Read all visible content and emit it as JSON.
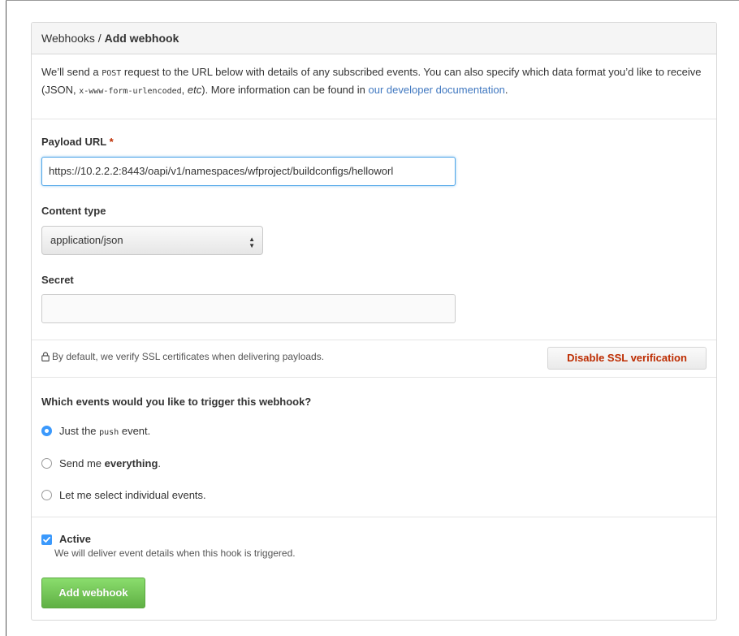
{
  "header": {
    "breadcrumb_parent": "Webhooks",
    "breadcrumb_sep": " / ",
    "breadcrumb_current": "Add webhook"
  },
  "intro": {
    "text1": "We’ll send a ",
    "code1": "POST",
    "text2": " request to the URL below with details of any subscribed events. You can also specify which data format you’d like to receive (JSON, ",
    "code2": "x-www-form-urlencoded",
    "text3": ", ",
    "etc": "etc",
    "text4": "). More information can be found in ",
    "link": "our developer documentation",
    "text5": "."
  },
  "form": {
    "payload_label": "Payload URL",
    "required_mark": "*",
    "payload_value": "https://10.2.2.2:8443/oapi/v1/namespaces/wfproject/buildconfigs/helloworl",
    "content_type_label": "Content type",
    "content_type_value": "application/json",
    "secret_label": "Secret",
    "secret_value": ""
  },
  "ssl": {
    "text": "By default, we verify SSL certificates when delivering payloads.",
    "button": "Disable SSL verification"
  },
  "events": {
    "question": "Which events would you like to trigger this webhook?",
    "opt1_a": "Just the ",
    "opt1_code": "push",
    "opt1_b": " event.",
    "opt2_a": "Send me ",
    "opt2_b": "everything",
    "opt2_c": ".",
    "opt3": "Let me select individual events."
  },
  "active": {
    "label": "Active",
    "note": "We will deliver event details when this hook is triggered.",
    "checked": true
  },
  "submit": {
    "label": "Add webhook"
  },
  "colors": {
    "link": "#4078c0",
    "danger": "#bd2c00",
    "radio_checked": "#3b99fc",
    "primary_button": "#60b044"
  }
}
